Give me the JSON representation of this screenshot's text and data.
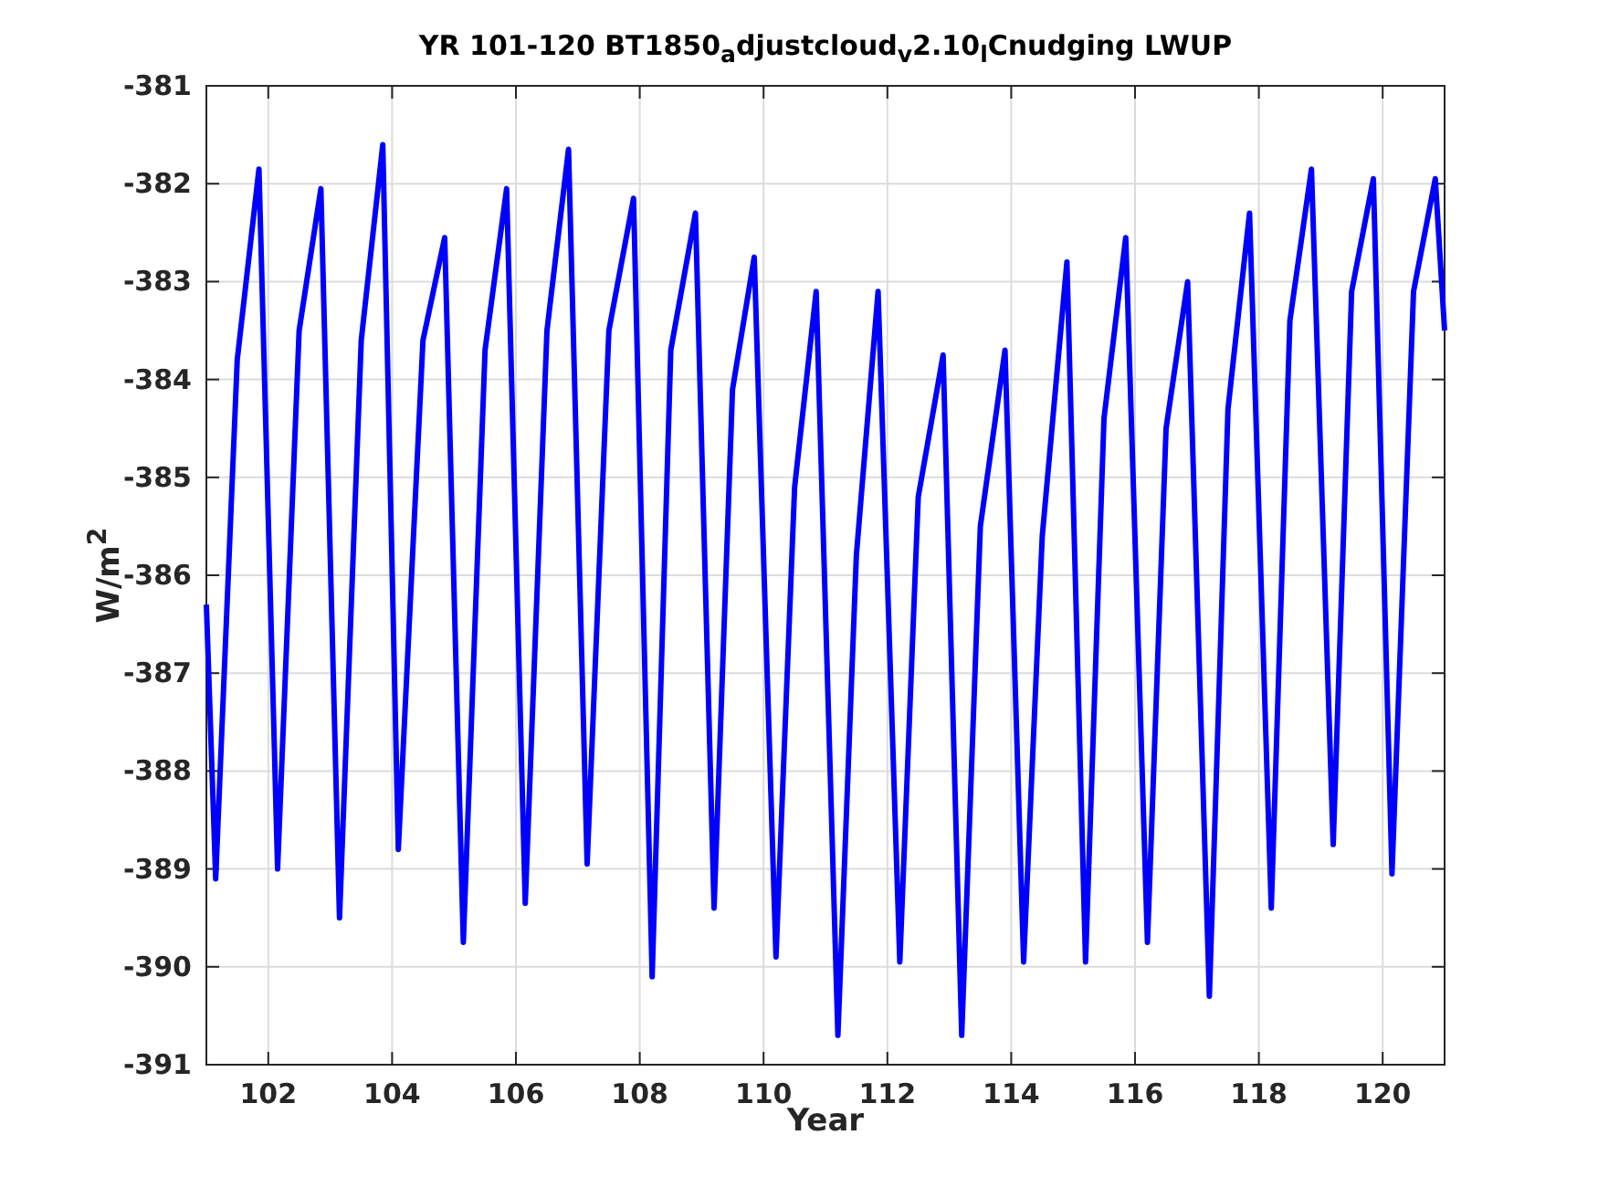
{
  "figure": {
    "chart_data": {
      "type": "line",
      "grid": true,
      "title": "YR 101-120 BT1850$_{a}$djustcloud$_{v}$2.10$_{l}$Cnudging LWUP",
      "xlabel": "Year",
      "ylabel": "W/m$^{2}$",
      "xlim": [
        101,
        121
      ],
      "ylim": [
        -391,
        -381
      ],
      "xticks": [
        102,
        104,
        106,
        108,
        110,
        112,
        114,
        116,
        118,
        120
      ],
      "yticks": [
        -391,
        -390,
        -389,
        -388,
        -387,
        -386,
        -385,
        -384,
        -383,
        -382,
        -381
      ],
      "x": [
        101,
        101.15,
        101.5,
        101.85,
        102.15,
        102.5,
        102.85,
        103.15,
        103.5,
        103.85,
        104.1,
        104.5,
        104.85,
        105.15,
        105.5,
        105.85,
        106.15,
        106.5,
        106.85,
        107.15,
        107.5,
        107.9,
        108.2,
        108.5,
        108.9,
        109.2,
        109.5,
        109.85,
        110.2,
        110.5,
        110.85,
        111.2,
        111.5,
        111.85,
        112.2,
        112.5,
        112.9,
        113.2,
        113.5,
        113.9,
        114.2,
        114.5,
        114.9,
        115.2,
        115.5,
        115.85,
        116.2,
        116.5,
        116.85,
        117.2,
        117.5,
        117.85,
        118.2,
        118.5,
        118.85,
        119.2,
        119.5,
        119.85,
        120.15,
        120.5,
        120.85,
        121
      ],
      "series": [
        {
          "color": "#0000ff",
          "values": [
            -386.3,
            -389.1,
            -383.8,
            -381.85,
            -389.0,
            -383.5,
            -382.05,
            -389.5,
            -383.6,
            -381.6,
            -388.8,
            -383.6,
            -382.55,
            -389.75,
            -383.7,
            -382.05,
            -389.35,
            -383.5,
            -381.65,
            -388.95,
            -383.5,
            -382.15,
            -390.1,
            -383.7,
            -382.3,
            -389.4,
            -384.1,
            -382.75,
            -389.9,
            -385.1,
            -383.1,
            -390.7,
            -385.8,
            -383.1,
            -389.95,
            -385.2,
            -383.75,
            -390.7,
            -385.5,
            -383.7,
            -389.95,
            -385.6,
            -382.8,
            -389.95,
            -384.4,
            -382.55,
            -389.75,
            -384.5,
            -383.0,
            -390.3,
            -384.3,
            -382.3,
            -389.4,
            -383.4,
            -381.85,
            -388.75,
            -383.1,
            -381.95,
            -389.05,
            -383.1,
            -381.95,
            -383.5
          ]
        }
      ]
    }
  }
}
